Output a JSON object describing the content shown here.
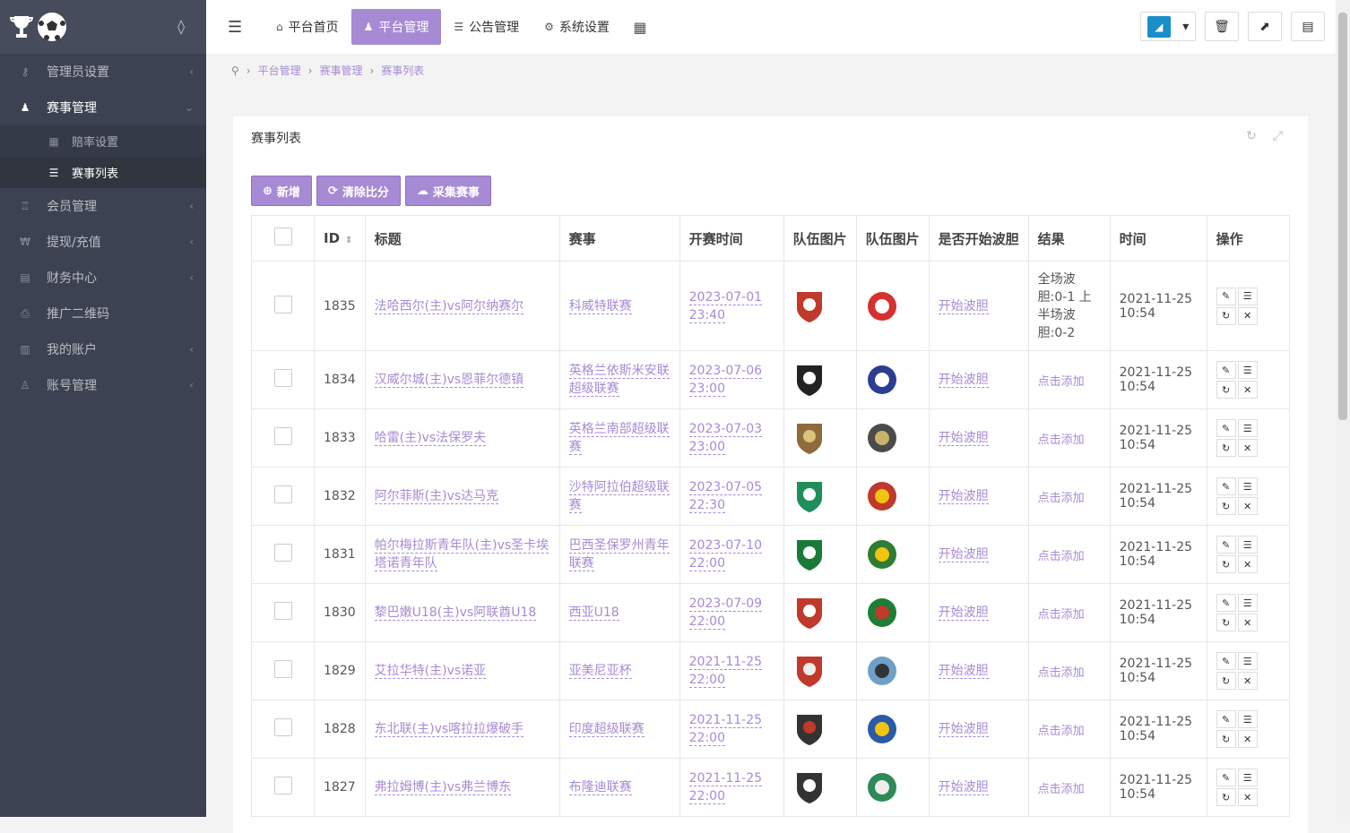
{
  "nav": {
    "items": [
      {
        "label": "平台首页",
        "icon": "home-icon"
      },
      {
        "label": "平台管理",
        "icon": "user-icon"
      },
      {
        "label": "公告管理",
        "icon": "list-icon"
      },
      {
        "label": "系统设置",
        "icon": "gear-icon"
      }
    ]
  },
  "sidebar": {
    "items": [
      {
        "label": "管理员设置",
        "icon": "key-icon"
      },
      {
        "label": "赛事管理",
        "icon": "users-icon"
      },
      {
        "label": "会员管理",
        "icon": "trophy-icon"
      },
      {
        "label": "提现/充值",
        "icon": "won-icon"
      },
      {
        "label": "财务中心",
        "icon": "calendar-icon"
      },
      {
        "label": "推广二维码",
        "icon": "print-icon"
      },
      {
        "label": "我的账户",
        "icon": "book-icon"
      },
      {
        "label": "账号管理",
        "icon": "user-icon"
      }
    ],
    "sub": [
      {
        "label": "赔率设置",
        "icon": "grid-icon"
      },
      {
        "label": "赛事列表",
        "icon": "list-icon"
      }
    ]
  },
  "breadcrumb": [
    "平台管理",
    "赛事管理",
    "赛事列表"
  ],
  "panel": {
    "title": "赛事列表"
  },
  "actions": {
    "add": "新增",
    "clear": "清除比分",
    "collect": "采集赛事"
  },
  "table": {
    "headers": [
      "ID",
      "标题",
      "赛事",
      "开赛时间",
      "队伍图片",
      "队伍图片",
      "是否开始波胆",
      "结果",
      "时间",
      "操作"
    ],
    "rows": [
      {
        "id": "1835",
        "title": "法哈西尔(主)vs阿尔纳赛尔",
        "league": "科威特联赛",
        "start1": "2023-07-01",
        "start2": "23:40",
        "bodan": "开始波胆",
        "result": "全场波胆:0-1 上半场波胆:0-2",
        "t1": "2021-11-25",
        "t2": "10:54"
      },
      {
        "id": "1834",
        "title": "汉威尔城(主)vs恩菲尔德镇",
        "league": "英格兰依斯米安联超级联赛",
        "start1": "2023-07-06",
        "start2": "23:00",
        "bodan": "开始波胆",
        "result": "点击添加",
        "t1": "2021-11-25",
        "t2": "10:54"
      },
      {
        "id": "1833",
        "title": "哈雷(主)vs法保罗夫",
        "league": "英格兰南部超级联赛",
        "start1": "2023-07-03",
        "start2": "23:00",
        "bodan": "开始波胆",
        "result": "点击添加",
        "t1": "2021-11-25",
        "t2": "10:54"
      },
      {
        "id": "1832",
        "title": "阿尔菲斯(主)vs达马克",
        "league": "沙特阿拉伯超级联赛",
        "start1": "2023-07-05",
        "start2": "22:30",
        "bodan": "开始波胆",
        "result": "点击添加",
        "t1": "2021-11-25",
        "t2": "10:54"
      },
      {
        "id": "1831",
        "title": "帕尔梅拉斯青年队(主)vs圣卡埃塔诺青年队",
        "league": "巴西圣保罗州青年联赛",
        "start1": "2023-07-10",
        "start2": "22:00",
        "bodan": "开始波胆",
        "result": "点击添加",
        "t1": "2021-11-25",
        "t2": "10:54"
      },
      {
        "id": "1830",
        "title": "黎巴嫩U18(主)vs阿联酋U18",
        "league": "西亚U18",
        "start1": "2023-07-09",
        "start2": "22:00",
        "bodan": "开始波胆",
        "result": "点击添加",
        "t1": "2021-11-25",
        "t2": "10:54"
      },
      {
        "id": "1829",
        "title": "艾拉华特(主)vs诺亚",
        "league": "亚美尼亚杯",
        "start1": "2021-11-25",
        "start2": "22:00",
        "bodan": "开始波胆",
        "result": "点击添加",
        "t1": "2021-11-25",
        "t2": "10:54"
      },
      {
        "id": "1828",
        "title": "东北联(主)vs喀拉拉爆破手",
        "league": "印度超级联赛",
        "start1": "2021-11-25",
        "start2": "22:00",
        "bodan": "开始波胆",
        "result": "点击添加",
        "t1": "2021-11-25",
        "t2": "10:54"
      },
      {
        "id": "1827",
        "title": "弗拉姆博(主)vs弗兰博东",
        "league": "布隆迪联赛",
        "start1": "2021-11-25",
        "start2": "22:00",
        "bodan": "开始波胆",
        "result": "点击添加",
        "t1": "2021-11-25",
        "t2": "10:54"
      }
    ]
  },
  "colors": {
    "accent": "#a78ad4",
    "sidebar": "#3c4251"
  }
}
